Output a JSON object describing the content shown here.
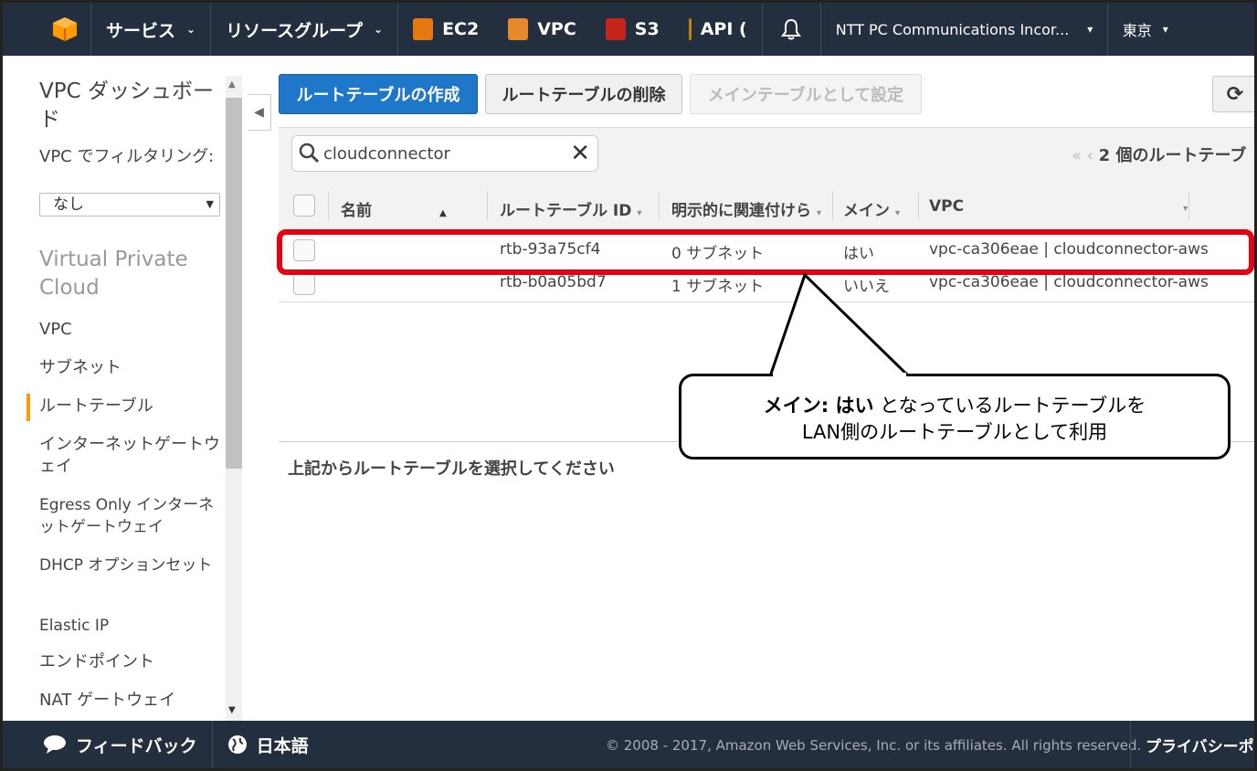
{
  "nav": {
    "services": "サービス",
    "resource_groups": "リソースグループ",
    "ec2": "EC2",
    "vpc": "VPC",
    "s3": "S3",
    "api": "API (",
    "account": "NTT PC Communications Incor...",
    "region": "東京"
  },
  "sidebar": {
    "title": "VPC ダッシュボード",
    "filter_label": "VPC でフィルタリング:",
    "filter_value": "なし",
    "section": "Virtual Private Cloud",
    "items": [
      {
        "label": "VPC"
      },
      {
        "label": "サブネット"
      },
      {
        "label": "ルートテーブル"
      },
      {
        "label": "インターネットゲートウェイ"
      },
      {
        "label": "Egress Only インターネットゲートウェイ"
      },
      {
        "label": "DHCP オプションセット"
      },
      {
        "label": "Elastic IP"
      },
      {
        "label": "エンドポイント"
      },
      {
        "label": "NAT ゲートウェイ"
      }
    ]
  },
  "toolbar": {
    "create": "ルートテーブルの作成",
    "delete": "ルートテーブルの削除",
    "set_main": "メインテーブルとして設定"
  },
  "filter": {
    "search_value": "cloudconnector",
    "pager_text": "2 個のルートテーブ"
  },
  "table": {
    "columns": [
      "名前",
      "ルートテーブル ID",
      "明示的に関連付けら",
      "メイン",
      "VPC"
    ],
    "rows": [
      {
        "name": "",
        "id": "rtb-93a75cf4",
        "assoc": "0 サブネット",
        "main": "はい",
        "vpc": "vpc-ca306eae | cloudconnector-aws"
      },
      {
        "name": "",
        "id": "rtb-b0a05bd7",
        "assoc": "1 サブネット",
        "main": "いいえ",
        "vpc": "vpc-ca306eae | cloudconnector-aws"
      }
    ]
  },
  "detail": {
    "message": "上記からルートテーブルを選択してください"
  },
  "callout": {
    "bold1": "メイン: はい",
    "line1_rest": " となっているルートテーブルを",
    "line2": "LAN側のルートテーブルとして利用"
  },
  "footer": {
    "feedback": "フィードバック",
    "language": "日本語",
    "copyright": "© 2008 - 2017, Amazon Web Services, Inc. or its affiliates. All rights reserved.",
    "privacy": "プライバシーポリ"
  },
  "colors": {
    "nav_bg": "#232f3e",
    "primary": "#1f77c9",
    "highlight": "#e60012",
    "active_bar": "#ff9900"
  }
}
